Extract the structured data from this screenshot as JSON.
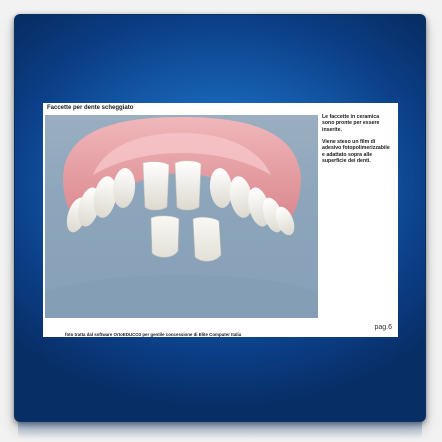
{
  "slide": {
    "title": "Faccette per dente scheggiato",
    "side_text_1": "Le faccette in ceramica sono pronte per essere inserite.",
    "side_text_2": "Viene steso un film di adesivo fotopolimerizzabile e adattato sopra alle superficie dei denti.",
    "page": "pag.6",
    "credit": "foto tratta dal software OrtoEDUCO3 per gentile concessione di Elite Computer Italia"
  },
  "colors": {
    "frame_accent": "#1660b0",
    "photo_background": "#8ca5bb",
    "gum": "#e39a9e",
    "tooth": "#f3f1ea"
  },
  "image": {
    "subject": "dental-veneers-illustration"
  }
}
